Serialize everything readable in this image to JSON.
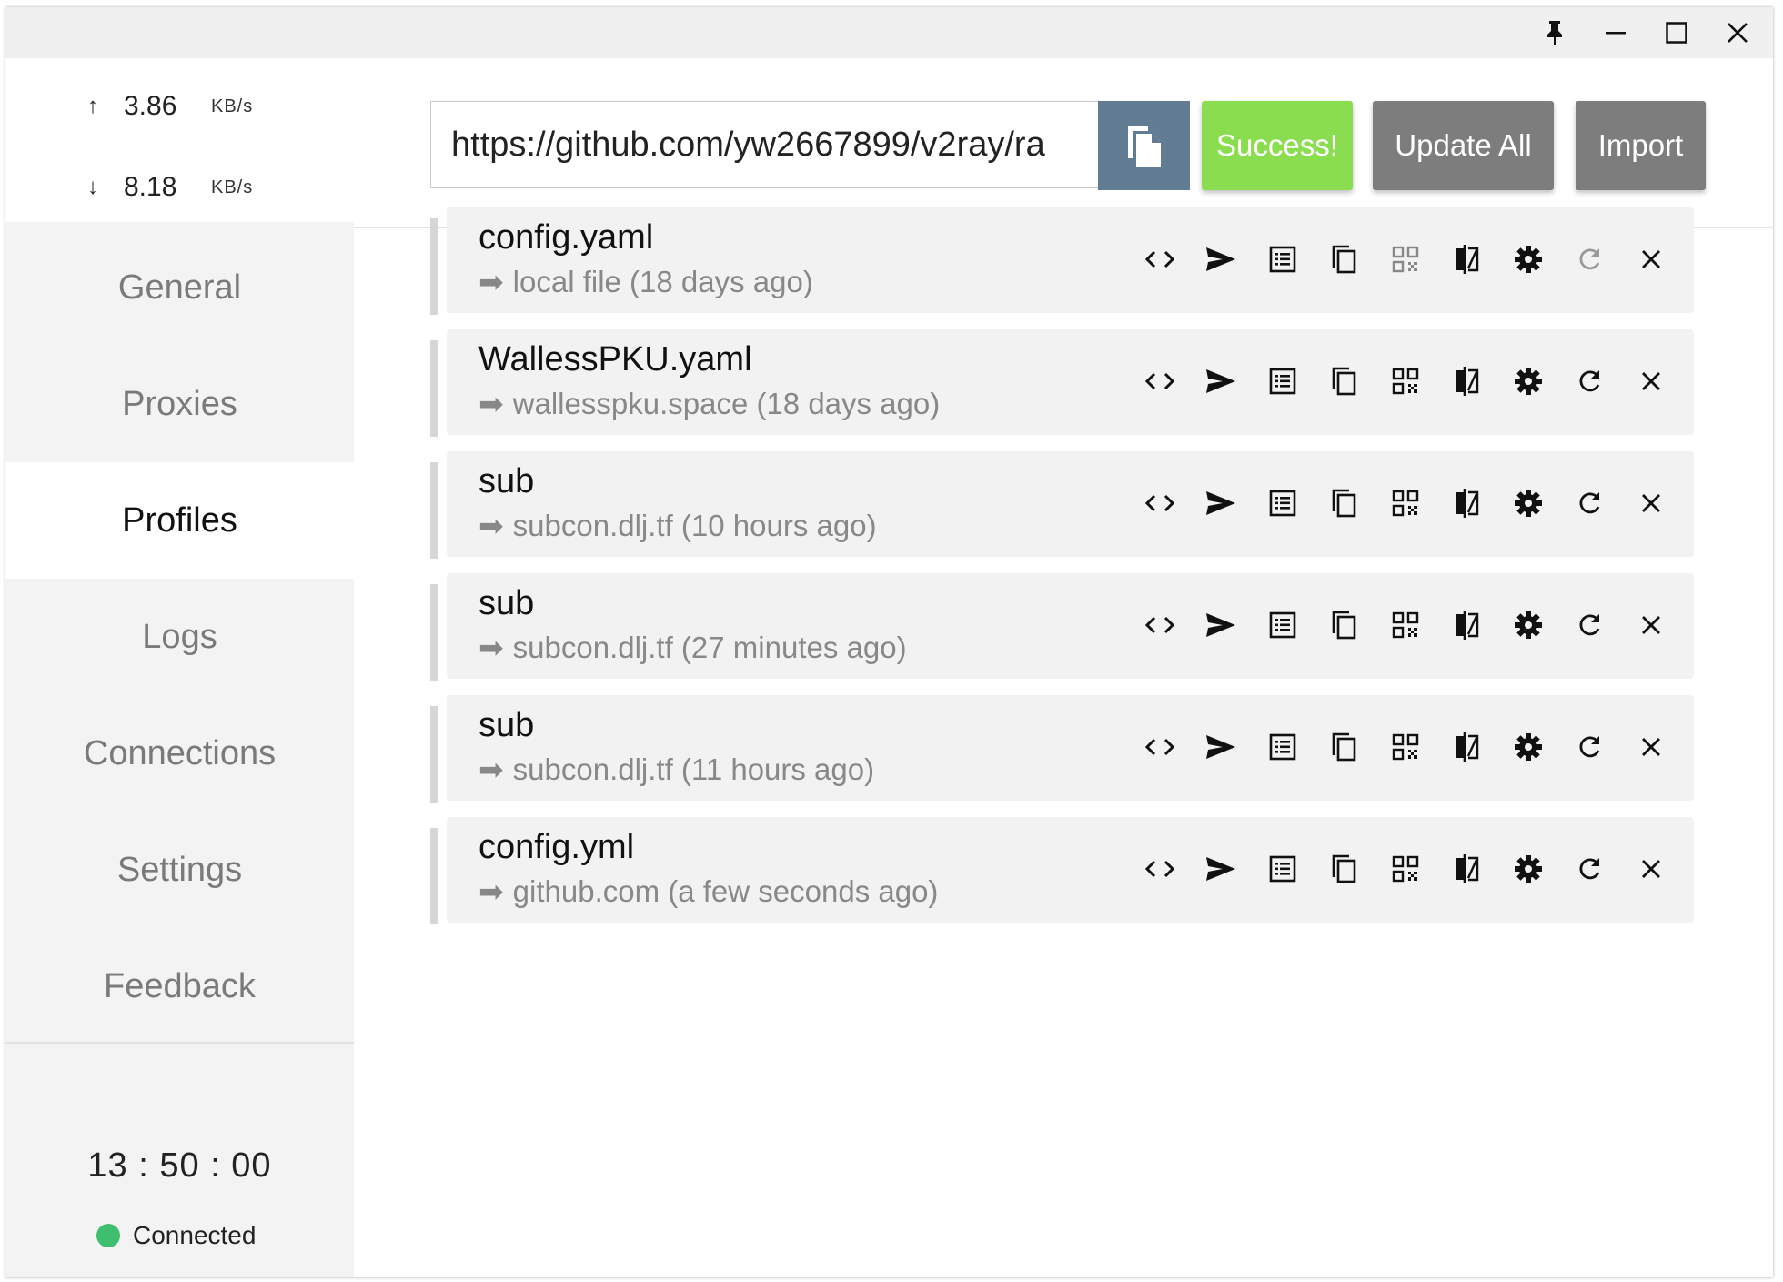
{
  "window": {
    "controls": [
      {
        "icon": "pin-icon"
      },
      {
        "icon": "minimize-icon"
      },
      {
        "icon": "maximize-icon"
      },
      {
        "icon": "close-icon"
      }
    ]
  },
  "traffic": {
    "upload": {
      "arrow": "↑",
      "value": "3.86",
      "unit": "KB/s"
    },
    "download": {
      "arrow": "↓",
      "value": "8.18",
      "unit": "KB/s"
    }
  },
  "nav": {
    "items": [
      {
        "label": "General"
      },
      {
        "label": "Proxies"
      },
      {
        "label": "Profiles",
        "active": true
      },
      {
        "label": "Logs"
      },
      {
        "label": "Connections"
      },
      {
        "label": "Settings"
      },
      {
        "label": "Feedback"
      }
    ]
  },
  "status": {
    "clock": "13 : 50 : 00",
    "connection": "Connected",
    "connection_color": "#3ebf6f"
  },
  "topbar": {
    "url_value": "https://github.com/yw2667899/v2ray/ra",
    "paste_icon": "paste-icon",
    "success_label": "Success!",
    "update_all_label": "Update All",
    "import_label": "Import"
  },
  "profiles": [
    {
      "name": "config.yaml",
      "source": "local file (18 days ago)"
    },
    {
      "name": "WallessPKU.yaml",
      "source": "wallesspku.space (18 days ago)"
    },
    {
      "name": "sub",
      "source": "subcon.dlj.tf (10 hours ago)"
    },
    {
      "name": "sub",
      "source": "subcon.dlj.tf (27 minutes ago)"
    },
    {
      "name": "sub",
      "source": "subcon.dlj.tf (11 hours ago)"
    },
    {
      "name": "config.yml",
      "source": "github.com (a few seconds ago)"
    }
  ],
  "profile_actions": [
    "code-icon",
    "send-icon",
    "list-icon",
    "copy-icon",
    "qrcode-icon",
    "compare-icon",
    "gear-icon",
    "refresh-icon",
    "close-icon"
  ],
  "colors": {
    "success": "#8add4f",
    "button_gray": "#7d7d7d",
    "paste_button": "#627c94"
  }
}
